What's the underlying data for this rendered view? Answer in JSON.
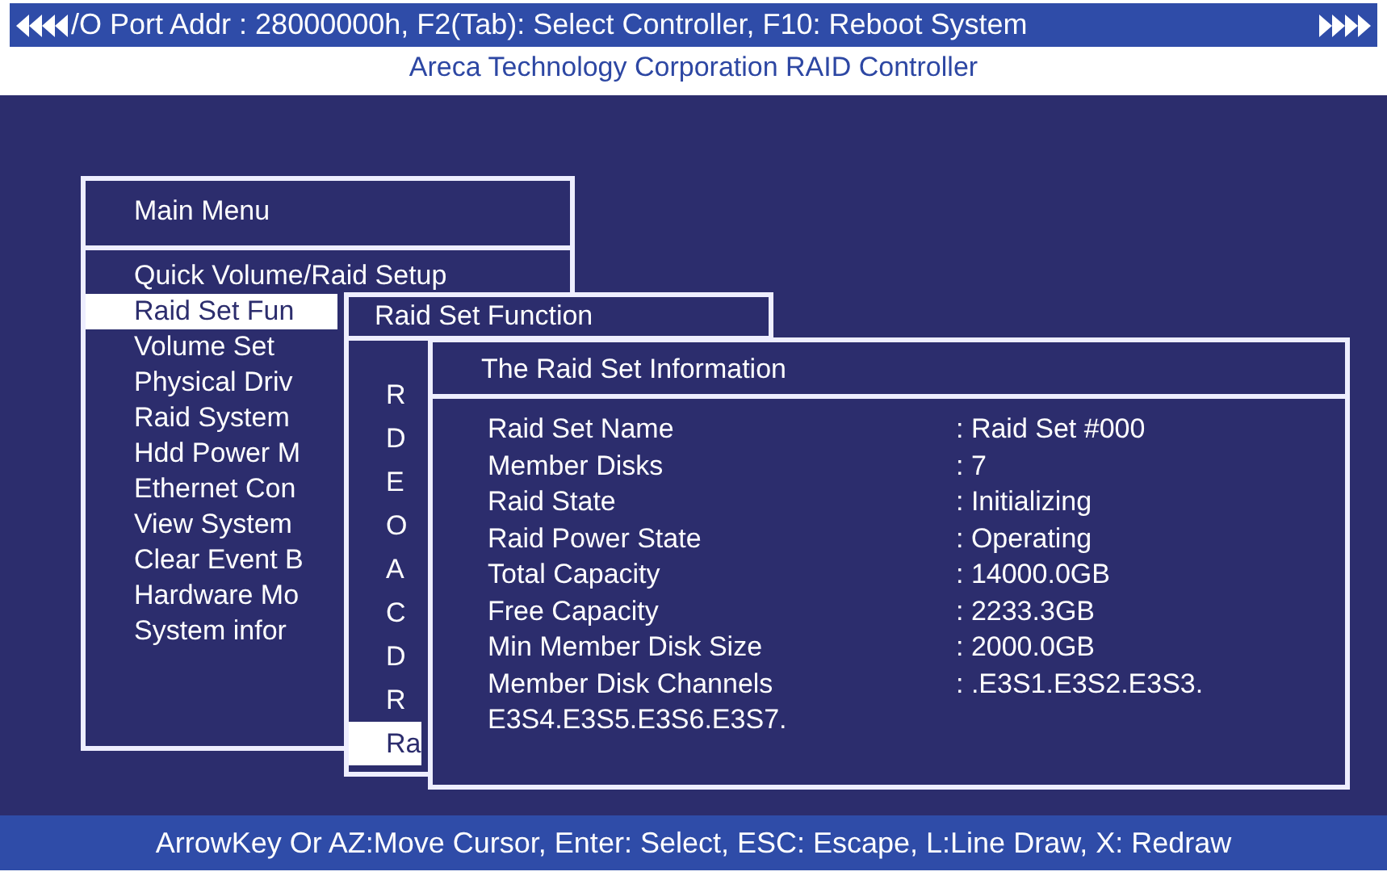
{
  "top_bar": {
    "text": "/O Port Addr : 28000000h, F2(Tab): Select Controller, F10: Reboot System"
  },
  "subtitle": "Areca Technology Corporation RAID Controller",
  "main_menu": {
    "title": "Main Menu",
    "items": [
      {
        "label": "Quick Volume/Raid Setup",
        "selected": false
      },
      {
        "label": "Raid Set Fun",
        "selected": true
      },
      {
        "label": "Volume Set",
        "selected": false
      },
      {
        "label": "Physical Driv",
        "selected": false
      },
      {
        "label": "Raid System",
        "selected": false
      },
      {
        "label": "Hdd Power M",
        "selected": false
      },
      {
        "label": "Ethernet Con",
        "selected": false
      },
      {
        "label": "View System",
        "selected": false
      },
      {
        "label": "Clear Event B",
        "selected": false
      },
      {
        "label": "Hardware Mo",
        "selected": false
      },
      {
        "label": "System infor",
        "selected": false
      }
    ]
  },
  "submenu": {
    "title": "Raid Set Function",
    "items": [
      {
        "label": "R",
        "selected": false
      },
      {
        "label": "D",
        "selected": false
      },
      {
        "label": "E",
        "selected": false
      },
      {
        "label": "O",
        "selected": false
      },
      {
        "label": "A",
        "selected": false
      },
      {
        "label": "C",
        "selected": false
      },
      {
        "label": "D",
        "selected": false
      },
      {
        "label": "R",
        "selected": false
      },
      {
        "label": "Ra",
        "selected": true
      }
    ]
  },
  "info_window": {
    "title": "The Raid Set Information",
    "rows": [
      {
        "label": "Raid Set Name",
        "value": ": Raid Set #000"
      },
      {
        "label": "Member Disks",
        "value": ":  7"
      },
      {
        "label": "Raid State",
        "value": ": Initializing"
      },
      {
        "label": "Raid Power State",
        "value": ": Operating"
      },
      {
        "label": "Total Capacity",
        "value": ": 14000.0GB"
      },
      {
        "label": "Free Capacity",
        "value": ": 2233.3GB"
      },
      {
        "label": "Min Member Disk Size",
        "value": ": 2000.0GB"
      },
      {
        "label": "Member Disk Channels",
        "value": ": .E3S1.E3S2.E3S3."
      }
    ],
    "continuation": "E3S4.E3S5.E3S6.E3S7."
  },
  "status_bar": "ArrowKey Or AZ:Move Cursor, Enter: Select, ESC: Escape, L:Line Draw, X: Redraw"
}
